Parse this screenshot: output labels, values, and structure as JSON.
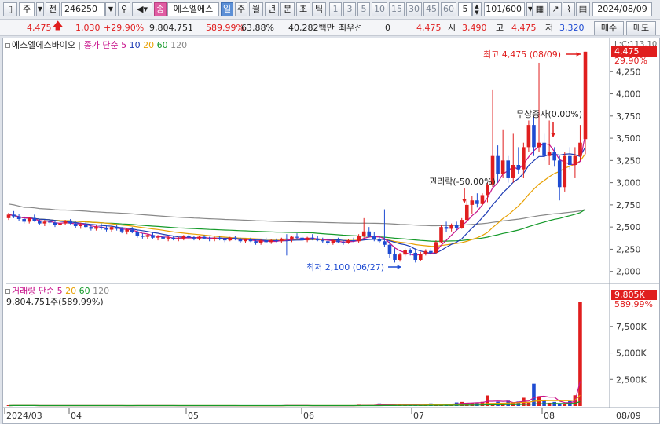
{
  "toolbar": {
    "market": "주",
    "mode": "전",
    "code": "246250",
    "name": "에스엘에스",
    "periods": [
      "일",
      "주",
      "월",
      "년",
      "분",
      "초",
      "틱"
    ],
    "active_period": "일",
    "numbers": [
      "1",
      "3",
      "5",
      "10",
      "15",
      "30",
      "45",
      "60"
    ],
    "count_value": "5",
    "page_counter": "101/600",
    "date": "2024/08/09"
  },
  "quote": {
    "price": "4,475",
    "change": "1,030",
    "change_pct": "+29.90%",
    "volume": "9,804,751",
    "volume_ratio": "589.99%",
    "turnover_pct": "63.88%",
    "amount": "40,282백만",
    "priority_label": "최우선",
    "priority_value": "0",
    "current": "4,475",
    "open_label": "시",
    "open": "3,490",
    "high_label": "고",
    "high": "4,475",
    "low_label": "저",
    "low": "3,320",
    "buy_label": "매수",
    "sell_label": "매도"
  },
  "legend_price": {
    "name": "에스엘에스바이오",
    "label": "종가 단순",
    "ma1": "5",
    "ma2": "10",
    "ma3": "20",
    "ma4": "60",
    "ma5": "120"
  },
  "legend_volume": {
    "label": "거래량 단순",
    "ma1": "5",
    "ma2": "20",
    "ma3": "60",
    "ma4": "120",
    "readout": "9,804,751주(589.99%)"
  },
  "annotations": {
    "high": "최고 4,475 (08/09)",
    "low": "최저 2,100 (06/27)",
    "rights": "권리락(-50.00%)",
    "bonus": "무상증자(0.00%)"
  },
  "price_axis": {
    "ticks": [
      "4,250",
      "4,000",
      "3,750",
      "3,500",
      "3,250",
      "3,000",
      "2,750",
      "2,500",
      "2,250",
      "2,000"
    ],
    "cap_label": "L:C:113.10",
    "current_tag": "4,475",
    "pct_tag": "29.90%"
  },
  "volume_axis": {
    "ticks": [
      "7,500K",
      "5,000K",
      "2,500K"
    ],
    "current_tag": "9,805K",
    "pct_tag": "589.99%"
  },
  "date_axis": {
    "labels": [
      "2024/03",
      "04",
      "05",
      "06",
      "07",
      "08"
    ],
    "right_label": "08/09"
  },
  "colors": {
    "up": "#e01e1e",
    "down": "#1e4bd2",
    "ma5": "#c8148c",
    "ma10": "#1e3cb4",
    "ma20": "#e8a000",
    "ma60": "#159a2a",
    "ma120": "#888888"
  },
  "chart_data": {
    "type": "candlestick",
    "ylim": [
      2000,
      4475
    ],
    "candles": [
      {
        "o": 2600,
        "h": 2660,
        "l": 2580,
        "c": 2640
      },
      {
        "o": 2640,
        "h": 2680,
        "l": 2600,
        "c": 2620
      },
      {
        "o": 2620,
        "h": 2650,
        "l": 2570,
        "c": 2590
      },
      {
        "o": 2590,
        "h": 2620,
        "l": 2540,
        "c": 2560
      },
      {
        "o": 2560,
        "h": 2610,
        "l": 2540,
        "c": 2600
      },
      {
        "o": 2600,
        "h": 2640,
        "l": 2560,
        "c": 2570
      },
      {
        "o": 2570,
        "h": 2590,
        "l": 2520,
        "c": 2540
      },
      {
        "o": 2540,
        "h": 2580,
        "l": 2510,
        "c": 2560
      },
      {
        "o": 2560,
        "h": 2590,
        "l": 2530,
        "c": 2550
      },
      {
        "o": 2550,
        "h": 2570,
        "l": 2500,
        "c": 2520
      },
      {
        "o": 2520,
        "h": 2560,
        "l": 2500,
        "c": 2540
      },
      {
        "o": 2540,
        "h": 2580,
        "l": 2520,
        "c": 2570
      },
      {
        "o": 2570,
        "h": 2590,
        "l": 2530,
        "c": 2540
      },
      {
        "o": 2540,
        "h": 2560,
        "l": 2490,
        "c": 2510
      },
      {
        "o": 2510,
        "h": 2550,
        "l": 2480,
        "c": 2530
      },
      {
        "o": 2530,
        "h": 2560,
        "l": 2490,
        "c": 2500
      },
      {
        "o": 2500,
        "h": 2530,
        "l": 2460,
        "c": 2480
      },
      {
        "o": 2480,
        "h": 2520,
        "l": 2460,
        "c": 2500
      },
      {
        "o": 2500,
        "h": 2540,
        "l": 2470,
        "c": 2490
      },
      {
        "o": 2490,
        "h": 2520,
        "l": 2450,
        "c": 2470
      },
      {
        "o": 2470,
        "h": 2510,
        "l": 2440,
        "c": 2500
      },
      {
        "o": 2500,
        "h": 2530,
        "l": 2460,
        "c": 2480
      },
      {
        "o": 2480,
        "h": 2500,
        "l": 2430,
        "c": 2450
      },
      {
        "o": 2450,
        "h": 2490,
        "l": 2420,
        "c": 2470
      },
      {
        "o": 2470,
        "h": 2500,
        "l": 2430,
        "c": 2440
      },
      {
        "o": 2440,
        "h": 2470,
        "l": 2380,
        "c": 2400
      },
      {
        "o": 2400,
        "h": 2430,
        "l": 2370,
        "c": 2390
      },
      {
        "o": 2390,
        "h": 2420,
        "l": 2360,
        "c": 2410
      },
      {
        "o": 2410,
        "h": 2440,
        "l": 2370,
        "c": 2380
      },
      {
        "o": 2380,
        "h": 2410,
        "l": 2350,
        "c": 2390
      },
      {
        "o": 2390,
        "h": 2420,
        "l": 2360,
        "c": 2370
      },
      {
        "o": 2370,
        "h": 2400,
        "l": 2340,
        "c": 2380
      },
      {
        "o": 2380,
        "h": 2400,
        "l": 2350,
        "c": 2360
      },
      {
        "o": 2360,
        "h": 2390,
        "l": 2340,
        "c": 2370
      },
      {
        "o": 2370,
        "h": 2410,
        "l": 2350,
        "c": 2400
      },
      {
        "o": 2400,
        "h": 2420,
        "l": 2370,
        "c": 2380
      },
      {
        "o": 2380,
        "h": 2400,
        "l": 2350,
        "c": 2370
      },
      {
        "o": 2370,
        "h": 2400,
        "l": 2350,
        "c": 2390
      },
      {
        "o": 2390,
        "h": 2410,
        "l": 2360,
        "c": 2370
      },
      {
        "o": 2370,
        "h": 2390,
        "l": 2340,
        "c": 2360
      },
      {
        "o": 2360,
        "h": 2390,
        "l": 2340,
        "c": 2380
      },
      {
        "o": 2380,
        "h": 2400,
        "l": 2350,
        "c": 2360
      },
      {
        "o": 2360,
        "h": 2380,
        "l": 2330,
        "c": 2350
      },
      {
        "o": 2350,
        "h": 2390,
        "l": 2340,
        "c": 2380
      },
      {
        "o": 2380,
        "h": 2400,
        "l": 2350,
        "c": 2360
      },
      {
        "o": 2360,
        "h": 2380,
        "l": 2320,
        "c": 2340
      },
      {
        "o": 2340,
        "h": 2370,
        "l": 2320,
        "c": 2360
      },
      {
        "o": 2360,
        "h": 2380,
        "l": 2330,
        "c": 2340
      },
      {
        "o": 2340,
        "h": 2360,
        "l": 2300,
        "c": 2320
      },
      {
        "o": 2320,
        "h": 2360,
        "l": 2300,
        "c": 2350
      },
      {
        "o": 2350,
        "h": 2380,
        "l": 2320,
        "c": 2330
      },
      {
        "o": 2330,
        "h": 2360,
        "l": 2310,
        "c": 2350
      },
      {
        "o": 2350,
        "h": 2370,
        "l": 2330,
        "c": 2340
      },
      {
        "o": 2340,
        "h": 2380,
        "l": 2320,
        "c": 2370
      },
      {
        "o": 2370,
        "h": 2420,
        "l": 2180,
        "c": 2360
      },
      {
        "o": 2360,
        "h": 2400,
        "l": 2330,
        "c": 2390
      },
      {
        "o": 2390,
        "h": 2430,
        "l": 2360,
        "c": 2380
      },
      {
        "o": 2380,
        "h": 2400,
        "l": 2340,
        "c": 2350
      },
      {
        "o": 2350,
        "h": 2390,
        "l": 2330,
        "c": 2380
      },
      {
        "o": 2380,
        "h": 2420,
        "l": 2350,
        "c": 2370
      },
      {
        "o": 2370,
        "h": 2400,
        "l": 2340,
        "c": 2350
      },
      {
        "o": 2350,
        "h": 2380,
        "l": 2320,
        "c": 2340
      },
      {
        "o": 2340,
        "h": 2370,
        "l": 2300,
        "c": 2320
      },
      {
        "o": 2320,
        "h": 2360,
        "l": 2300,
        "c": 2350
      },
      {
        "o": 2350,
        "h": 2380,
        "l": 2320,
        "c": 2330
      },
      {
        "o": 2330,
        "h": 2350,
        "l": 2300,
        "c": 2320
      },
      {
        "o": 2320,
        "h": 2360,
        "l": 2310,
        "c": 2350
      },
      {
        "o": 2350,
        "h": 2380,
        "l": 2330,
        "c": 2340
      },
      {
        "o": 2340,
        "h": 2420,
        "l": 2320,
        "c": 2400
      },
      {
        "o": 2400,
        "h": 2600,
        "l": 2380,
        "c": 2450
      },
      {
        "o": 2450,
        "h": 2500,
        "l": 2380,
        "c": 2400
      },
      {
        "o": 2400,
        "h": 2440,
        "l": 2340,
        "c": 2360
      },
      {
        "o": 2360,
        "h": 2400,
        "l": 2320,
        "c": 2340
      },
      {
        "o": 2340,
        "h": 2700,
        "l": 2280,
        "c": 2300
      },
      {
        "o": 2300,
        "h": 2350,
        "l": 2150,
        "c": 2200
      },
      {
        "o": 2200,
        "h": 2260,
        "l": 2100,
        "c": 2130
      },
      {
        "o": 2130,
        "h": 2210,
        "l": 2110,
        "c": 2190
      },
      {
        "o": 2190,
        "h": 2260,
        "l": 2170,
        "c": 2240
      },
      {
        "o": 2240,
        "h": 2260,
        "l": 2180,
        "c": 2210
      },
      {
        "o": 2210,
        "h": 2260,
        "l": 2100,
        "c": 2130
      },
      {
        "o": 2130,
        "h": 2220,
        "l": 2120,
        "c": 2200
      },
      {
        "o": 2200,
        "h": 2250,
        "l": 2180,
        "c": 2230
      },
      {
        "o": 2230,
        "h": 2260,
        "l": 2190,
        "c": 2210
      },
      {
        "o": 2210,
        "h": 2350,
        "l": 2200,
        "c": 2330
      },
      {
        "o": 2330,
        "h": 2520,
        "l": 2320,
        "c": 2500
      },
      {
        "o": 2500,
        "h": 2560,
        "l": 2440,
        "c": 2480
      },
      {
        "o": 2480,
        "h": 2540,
        "l": 2450,
        "c": 2520
      },
      {
        "o": 2520,
        "h": 2560,
        "l": 2460,
        "c": 2490
      },
      {
        "o": 2490,
        "h": 2600,
        "l": 2480,
        "c": 2580
      },
      {
        "o": 2580,
        "h": 2800,
        "l": 2560,
        "c": 2750
      },
      {
        "o": 2750,
        "h": 2850,
        "l": 2650,
        "c": 2800
      },
      {
        "o": 2800,
        "h": 2880,
        "l": 2720,
        "c": 2760
      },
      {
        "o": 2760,
        "h": 2880,
        "l": 2740,
        "c": 2860
      },
      {
        "o": 2860,
        "h": 3000,
        "l": 2780,
        "c": 2980
      },
      {
        "o": 2980,
        "h": 4050,
        "l": 2950,
        "c": 3300
      },
      {
        "o": 3300,
        "h": 3420,
        "l": 3000,
        "c": 3100
      },
      {
        "o": 3100,
        "h": 3600,
        "l": 3050,
        "c": 3250
      },
      {
        "o": 3250,
        "h": 3300,
        "l": 3000,
        "c": 3050
      },
      {
        "o": 3050,
        "h": 3550,
        "l": 3000,
        "c": 3200
      },
      {
        "o": 3200,
        "h": 3400,
        "l": 3100,
        "c": 3150
      },
      {
        "o": 3150,
        "h": 3450,
        "l": 3050,
        "c": 3400
      },
      {
        "o": 3400,
        "h": 3700,
        "l": 3350,
        "c": 3650
      },
      {
        "o": 3650,
        "h": 3750,
        "l": 3300,
        "c": 3400
      },
      {
        "o": 3400,
        "h": 4350,
        "l": 3350,
        "c": 3450
      },
      {
        "o": 3450,
        "h": 3550,
        "l": 3250,
        "c": 3300
      },
      {
        "o": 3300,
        "h": 3700,
        "l": 3200,
        "c": 3350
      },
      {
        "o": 3350,
        "h": 3400,
        "l": 3180,
        "c": 3250
      },
      {
        "o": 3250,
        "h": 3300,
        "l": 2800,
        "c": 2950
      },
      {
        "o": 2950,
        "h": 3350,
        "l": 2900,
        "c": 3300
      },
      {
        "o": 3300,
        "h": 3400,
        "l": 3150,
        "c": 3200
      },
      {
        "o": 3200,
        "h": 3400,
        "l": 3050,
        "c": 3300
      },
      {
        "o": 3300,
        "h": 3650,
        "l": 3250,
        "c": 3450
      },
      {
        "o": 3490,
        "h": 4475,
        "l": 3320,
        "c": 4475
      }
    ],
    "volume": [
      40,
      50,
      45,
      38,
      42,
      36,
      33,
      40,
      38,
      35,
      37,
      41,
      36,
      34,
      39,
      36,
      33,
      35,
      38,
      32,
      30,
      34,
      33,
      31,
      35,
      40,
      36,
      38,
      35,
      33,
      36,
      31,
      33,
      30,
      35,
      32,
      34,
      31,
      33,
      36,
      32,
      30,
      33,
      31,
      34,
      32,
      30,
      35,
      33,
      31,
      30,
      33,
      35,
      32,
      80,
      36,
      31,
      33,
      30,
      35,
      32,
      31,
      30,
      34,
      32,
      30,
      33,
      36,
      120,
      90,
      60,
      55,
      240,
      180,
      200,
      120,
      150,
      90,
      80,
      110,
      70,
      140,
      240,
      180,
      130,
      150,
      200,
      330,
      380,
      230,
      280,
      330,
      390,
      1000,
      220,
      400,
      190,
      500,
      300,
      420,
      780,
      320,
      2100,
      900,
      550,
      300,
      380,
      150,
      200,
      450,
      1020,
      9805
    ]
  }
}
